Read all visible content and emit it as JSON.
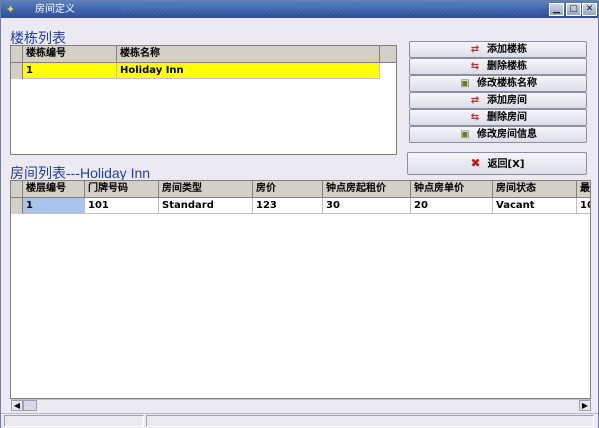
{
  "window": {
    "title": "房间定义"
  },
  "buildings": {
    "section_label": "楼栋列表",
    "columns": [
      "楼栋编号",
      "楼栋名称"
    ],
    "rows": [
      [
        "1",
        "Holiday Inn"
      ]
    ]
  },
  "buttons": {
    "add_building": "添加楼栋",
    "delete_building": "删除楼栋",
    "rename_building": "修改楼栋名称",
    "add_room": "添加房间",
    "delete_room": "删除房间",
    "edit_room": "修改房间信息",
    "return": "返回[X]"
  },
  "rooms": {
    "section_label": "房间列表---Holiday Inn",
    "columns": [
      "楼层编号",
      "门牌号码",
      "房间类型",
      "房价",
      "钟点房起租价",
      "钟点房单价",
      "房间状态",
      "最"
    ],
    "rows": [
      [
        "1",
        "101",
        "Standard",
        "123",
        "30",
        "20",
        "Vacant",
        "10"
      ]
    ]
  },
  "colors": {
    "selected_row": "#ffff00",
    "selected_cell": "#a9c4ec",
    "section_label": "#1f3ea8"
  }
}
